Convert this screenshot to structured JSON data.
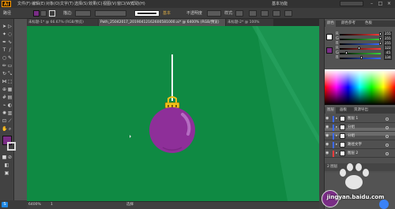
{
  "app": {
    "logo": "Ai",
    "menus": [
      "文件(F)",
      "编辑(E)",
      "对象(O)",
      "文字(T)",
      "选择(S)",
      "效果(C)",
      "视图(V)",
      "窗口(W)",
      "帮助(H)"
    ],
    "workspace": "基本功能"
  },
  "controlbar": {
    "selection_label": "路径",
    "stroke_label": "描边:",
    "profile_label": "基本",
    "opacity_label": "不透明度",
    "style_label": "样式:"
  },
  "tabs": [
    {
      "label": "未标题-1* @ 66.67% (RGB/预览)"
    },
    {
      "label": "Path_25042017_20190412162600581000.ai* @ 6400% (RGB/预览)"
    },
    {
      "label": "未标题-2* @ 100%"
    }
  ],
  "status": {
    "zoom": "6400%",
    "page": "1",
    "mode": "选择"
  },
  "panels": {
    "color_tabs": [
      "颜色",
      "颜色参考",
      "色板"
    ],
    "layer_tabs": [
      "图层",
      "画板",
      "资源导出"
    ],
    "sliders": [
      {
        "label": "R",
        "value": "255",
        "level": 1.0,
        "color": "#ff3b3b"
      },
      {
        "label": "G",
        "value": "255",
        "level": 1.0,
        "color": "#3bd23b"
      },
      {
        "label": "B",
        "value": "255",
        "level": 1.0,
        "color": "#3b6bff"
      }
    ],
    "sliders2": [
      {
        "label": "R",
        "value": "122",
        "level": 0.48,
        "color": "#ff3b3b"
      },
      {
        "label": "G",
        "value": "45",
        "level": 0.18,
        "color": "#3bd23b"
      },
      {
        "label": "B",
        "value": "134",
        "level": 0.53,
        "color": "#3b6bff"
      }
    ],
    "layers": [
      {
        "name": "图层 1",
        "color": "#3d6bff"
      },
      {
        "name": "分组",
        "color": "#3d6bff"
      },
      {
        "name": "分组",
        "color": "#3d6bff"
      },
      {
        "name": "路径文字",
        "color": "#3d6bff"
      },
      {
        "name": "图层 2",
        "color": "#ff3d3d"
      }
    ],
    "layers_footer": "2 图层"
  },
  "colors": {
    "canvas": "#0f8a43",
    "ornament": "#8e2f99",
    "ornament_highlight": "#b56cc2",
    "cap": "#f2c21b"
  },
  "watermark": "jingyan.baidu.com"
}
